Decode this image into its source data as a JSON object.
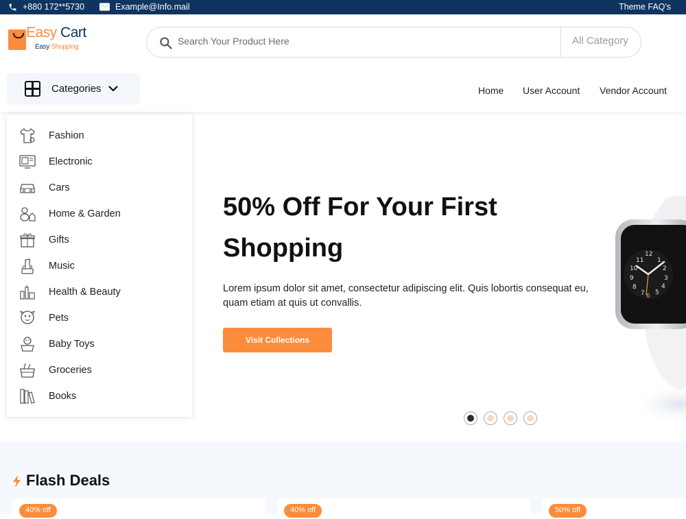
{
  "topbar": {
    "phone": "+880 172**5730",
    "email": "Example@Info.mail",
    "faq": "Theme FAQ's"
  },
  "logo": {
    "easy": "Easy",
    "cart": "Cart",
    "tag_easy": "Easy",
    "tag_shopping": "Shopping"
  },
  "search": {
    "placeholder": "Search Your Product Here",
    "category": "All Category"
  },
  "categories_button": "Categories",
  "nav": {
    "home": "Home",
    "user": "User Account",
    "vendor": "Vendor Account"
  },
  "sidebar": {
    "items": [
      {
        "label": "Fashion",
        "icon": "fashion-icon"
      },
      {
        "label": "Electronic",
        "icon": "electronic-icon"
      },
      {
        "label": "Cars",
        "icon": "car-icon"
      },
      {
        "label": "Home & Garden",
        "icon": "home-garden-icon"
      },
      {
        "label": "Gifts",
        "icon": "gift-icon"
      },
      {
        "label": "Music",
        "icon": "music-icon"
      },
      {
        "label": "Health & Beauty",
        "icon": "health-beauty-icon"
      },
      {
        "label": "Pets",
        "icon": "pet-icon"
      },
      {
        "label": "Baby Toys",
        "icon": "baby-toys-icon"
      },
      {
        "label": "Groceries",
        "icon": "groceries-icon"
      },
      {
        "label": "Books",
        "icon": "books-icon"
      }
    ]
  },
  "hero": {
    "title": "50% Off For Your First Shopping",
    "text": "Lorem ipsum dolor sit amet, consectetur adipiscing elit. Quis lobortis consequat eu, quam etiam at quis ut convallis.",
    "button": "Visit Collections",
    "slides": 4,
    "active_slide": 1
  },
  "flash": {
    "title": "Flash Deals",
    "badges": [
      "40% off",
      "40% off",
      "50% off"
    ]
  },
  "colors": {
    "accent": "#fb8c3c",
    "navy": "#0f3460"
  }
}
